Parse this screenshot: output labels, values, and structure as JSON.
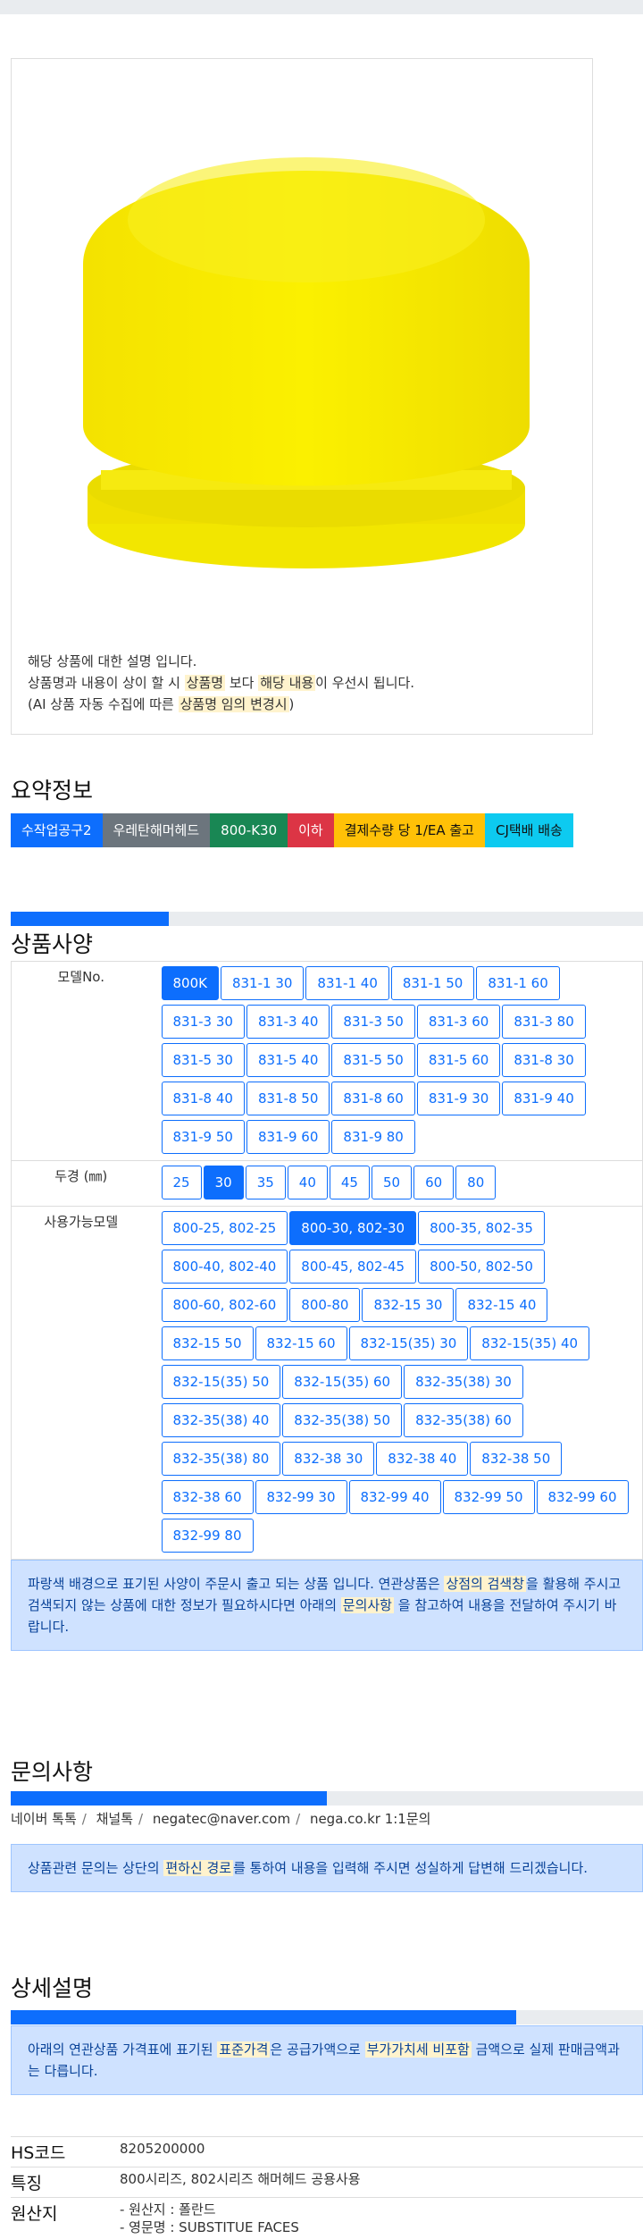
{
  "product_image": {
    "desc_line1": "해당 상품에 대한 설명 입니다.",
    "desc_line2_a": "상품명과 내용이 상이 할 시 ",
    "desc_line2_b": "상품명",
    "desc_line2_c": " 보다 ",
    "desc_line2_d": "해당 내용",
    "desc_line2_e": "이 우선시 됩니다.",
    "desc_line3_a": "(AI 상품 자동 수집에 따른 ",
    "desc_line3_b": "상품명 임의 변경시",
    "desc_line3_c": ")"
  },
  "summary": {
    "title": "요약정보",
    "chips": [
      {
        "label": "수작업공구2",
        "bg": "#0d6efd",
        "fg": "#ffffff"
      },
      {
        "label": "우레탄해머헤드",
        "bg": "#6c757d",
        "fg": "#ffffff"
      },
      {
        "label": "800-K30",
        "bg": "#198754",
        "fg": "#ffffff"
      },
      {
        "label": "이하",
        "bg": "#dc3545",
        "fg": "#ffffff"
      },
      {
        "label": "결제수량 당 1/EA 출고",
        "bg": "#ffc107",
        "fg": "#111111"
      },
      {
        "label": "CJ택배 배송",
        "bg": "#0dcaf0",
        "fg": "#111111"
      }
    ]
  },
  "spec": {
    "title": "상품사양",
    "progress": 0.25,
    "rows": [
      {
        "label": "모델No.",
        "options": [
          "800K",
          "831-1 30",
          "831-1 40",
          "831-1 50",
          "831-1 60",
          "831-3 30",
          "831-3 40",
          "831-3 50",
          "831-3 60",
          "831-3 80",
          "831-5 30",
          "831-5 40",
          "831-5 50",
          "831-5 60",
          "831-8 30",
          "831-8 40",
          "831-8 50",
          "831-8 60",
          "831-9 30",
          "831-9 40",
          "831-9 50",
          "831-9 60",
          "831-9 80"
        ],
        "selected": "800K"
      },
      {
        "label": "두경 (㎜)",
        "options": [
          "25",
          "30",
          "35",
          "40",
          "45",
          "50",
          "60",
          "80"
        ],
        "selected": "30"
      },
      {
        "label": "사용가능모델",
        "options": [
          "800-25, 802-25",
          "800-30, 802-30",
          "800-35, 802-35",
          "800-40, 802-40",
          "800-45, 802-45",
          "800-50, 802-50",
          "800-60, 802-60",
          "800-80",
          "832-15 30",
          "832-15 40",
          "832-15 50",
          "832-15 60",
          "832-15(35) 30",
          "832-15(35) 40",
          "832-15(35) 50",
          "832-15(35) 60",
          "832-35(38) 30",
          "832-35(38) 40",
          "832-35(38) 50",
          "832-35(38) 60",
          "832-35(38) 80",
          "832-38 30",
          "832-38 40",
          "832-38 50",
          "832-38 60",
          "832-99 30",
          "832-99 40",
          "832-99 50",
          "832-99 60",
          "832-99 80"
        ],
        "selected": "800-30, 802-30"
      }
    ],
    "note_a": "파랑색 배경으로 표기된 사양이 주문시 출고 되는 상품 입니다. 연관상품은 ",
    "note_b": "상점의 검색창",
    "note_c": "을 활용해 주시고 검색되지 않는 상품에 대한 정보가 필요하시다면 아래의 ",
    "note_d": "문의사항",
    "note_e": " 을 참고하여 내용을 전달하여 주시기 바랍니다."
  },
  "inquiry": {
    "title": "문의사항",
    "progress": 0.5,
    "links": [
      "네이버 톡톡",
      "채널톡",
      "negatec@naver.com",
      "nega.co.kr 1:1문의"
    ],
    "note_a": "상품관련 문의는 상단의 ",
    "note_b": "편하신 경로",
    "note_c": "를 통하여 내용을 입력해 주시면 성실하게 답변해 드리겠습니다."
  },
  "detail": {
    "title": "상세설명",
    "progress": 0.8,
    "note_a": "아래의 연관상품 가격표에 표기된 ",
    "note_b": "표준가격",
    "note_c": "은 공급가액으로 ",
    "note_d": "부가가치세 비포함",
    "note_e": " 금액으로 실제 판매금액과는 다릅니다.",
    "info": [
      {
        "key": "HS코드",
        "values": [
          "8205200000"
        ]
      },
      {
        "key": "특징",
        "values": [
          "800시리즈, 802시리즈 해머헤드 공용사용"
        ]
      },
      {
        "key": "원산지",
        "values": [
          "- 원산지 : 폴란드",
          "- 영문명 : SUBSTITUE FACES"
        ]
      }
    ]
  }
}
